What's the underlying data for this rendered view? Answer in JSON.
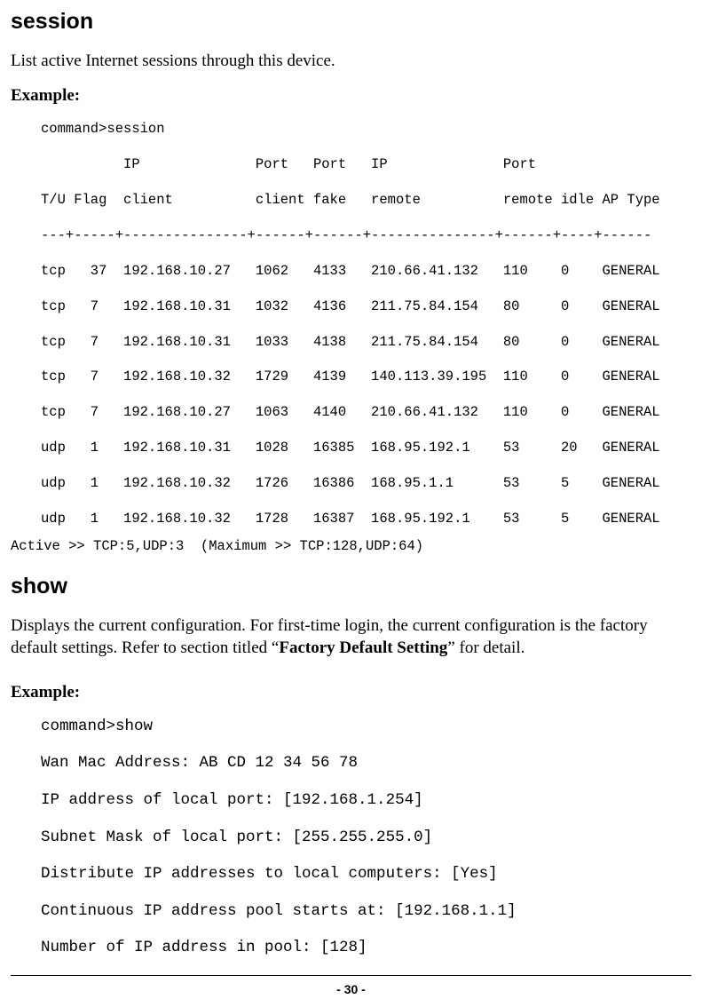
{
  "session": {
    "heading": "session",
    "description": "List active Internet sessions through this device.",
    "example_label": "Example:",
    "prompt_line": "command>session",
    "header_line1": "          IP              Port   Port   IP              Port",
    "header_line2": "T/U Flag  client          client fake   remote          remote idle AP Type",
    "divider": "---+-----+---------------+------+------+---------------+------+----+------",
    "rows": [
      "tcp   37  192.168.10.27   1062   4133   210.66.41.132   110    0    GENERAL",
      "tcp   7   192.168.10.31   1032   4136   211.75.84.154   80     0    GENERAL",
      "tcp   7   192.168.10.31   1033   4138   211.75.84.154   80     0    GENERAL",
      "tcp   7   192.168.10.32   1729   4139   140.113.39.195  110    0    GENERAL",
      "tcp   7   192.168.10.27   1063   4140   210.66.41.132   110    0    GENERAL",
      "udp   1   192.168.10.31   1028   16385  168.95.192.1    53     20   GENERAL",
      "udp   1   192.168.10.32   1726   16386  168.95.1.1      53     5    GENERAL",
      "udp   1   192.168.10.32   1728   16387  168.95.192.1    53     5    GENERAL"
    ],
    "active_line": "Active >> TCP:5,UDP:3  (Maximum >> TCP:128,UDP:64)"
  },
  "show": {
    "heading": "show",
    "desc_before": "Displays the current configuration. For first-time login, the current configuration is the factory default settings. Refer to section titled “",
    "desc_bold": "Factory Default Setting",
    "desc_after": "” for detail.",
    "example_label": "Example:",
    "prompt_line": "command>show",
    "lines": [
      "Wan Mac Address: AB CD 12 34 56 78",
      "IP address of local port: [192.168.1.254]",
      "Subnet Mask of local port: [255.255.255.0]",
      "Distribute IP addresses to local computers: [Yes]",
      "Continuous IP address pool starts at: [192.168.1.1]",
      "Number of IP address in pool: [128]"
    ]
  },
  "footer": {
    "page": "- 30 -"
  }
}
